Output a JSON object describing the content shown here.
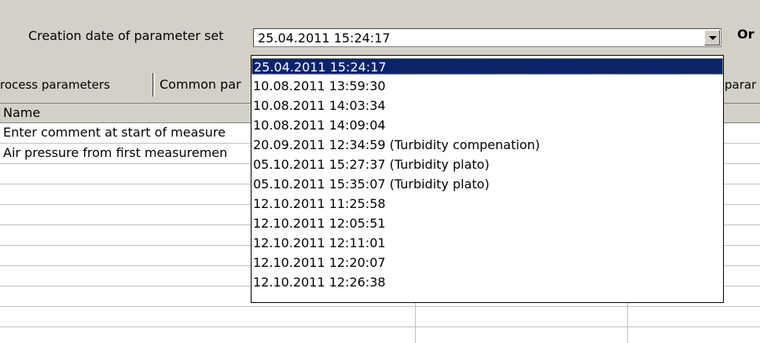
{
  "header": {
    "creation_label": "Creation date of parameter set",
    "combo_value": "25.04.2011 15:24:17",
    "or_label": "Or"
  },
  "tabs": [
    {
      "label": "rocess parameters"
    },
    {
      "label": "Common par"
    },
    {
      "label": "parar"
    }
  ],
  "grid": {
    "header_name": "Name",
    "rows": [
      "Enter comment at start of measure",
      "Air pressure from first measuremen",
      "",
      "",
      "",
      "",
      "",
      "",
      "",
      ""
    ]
  },
  "dropdown": {
    "items": [
      "25.04.2011 15:24:17",
      "10.08.2011 13:59:30",
      "10.08.2011 14:03:34",
      "10.08.2011 14:09:04",
      "20.09.2011 12:34:59 (Turbidity compenation)",
      "05.10.2011 15:27:37 (Turbidity plato)",
      "05.10.2011 15:35:07 (Turbidity plato)",
      "12.10.2011 11:25:58",
      "12.10.2011 12:05:51",
      "12.10.2011 12:11:01",
      "12.10.2011 12:20:07",
      "12.10.2011 12:26:38"
    ],
    "selected_index": 0
  }
}
